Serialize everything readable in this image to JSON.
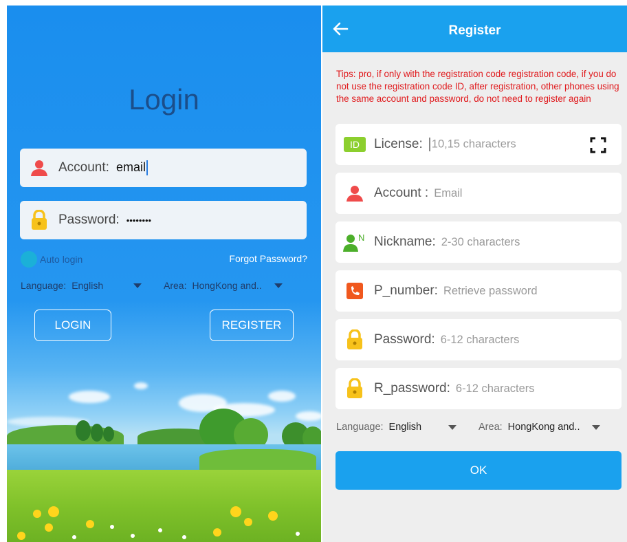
{
  "login": {
    "title": "Login",
    "account_label": "Account:",
    "account_value": "email",
    "password_label": "Password:",
    "password_value": "••••••••",
    "auto_login": "Auto login",
    "forgot_password": "Forgot Password?",
    "language_label": "Language:",
    "language_value": "English",
    "area_label": "Area:",
    "area_value": "HongKong and..",
    "login_button": "LOGIN",
    "register_button": "REGISTER"
  },
  "register": {
    "title": "Register",
    "tips": "Tips: pro, if only with the registration code registration code, if you do not use the registration code ID, after registration, other phones using the same account and password, do not need to register again",
    "fields": [
      {
        "label": "License:",
        "placeholder": "10,15 characters",
        "icon": "id-badge-icon"
      },
      {
        "label": "Account :",
        "placeholder": "Email",
        "icon": "person-icon"
      },
      {
        "label": "Nickname:",
        "placeholder": "2-30 characters",
        "icon": "nickname-icon"
      },
      {
        "label": "P_number:",
        "placeholder": "Retrieve password",
        "icon": "phone-icon"
      },
      {
        "label": "Password:",
        "placeholder": "6-12 characters",
        "icon": "lock-icon"
      },
      {
        "label": "R_password:",
        "placeholder": "6-12 characters",
        "icon": "lock-icon"
      }
    ],
    "id_badge_text": "ID",
    "nickname_badge_text": "N",
    "language_label": "Language:",
    "language_value": "English",
    "area_label": "Area:",
    "area_value": "HongKong and..",
    "ok_button": "OK"
  },
  "colors": {
    "login_bg": "#1a8eee",
    "appbar": "#1aa1ee",
    "tips_red": "#e0191c",
    "person_icon": "#ef4b4b",
    "lock_icon": "#f7c21b",
    "id_badge": "#8ccf2e"
  }
}
